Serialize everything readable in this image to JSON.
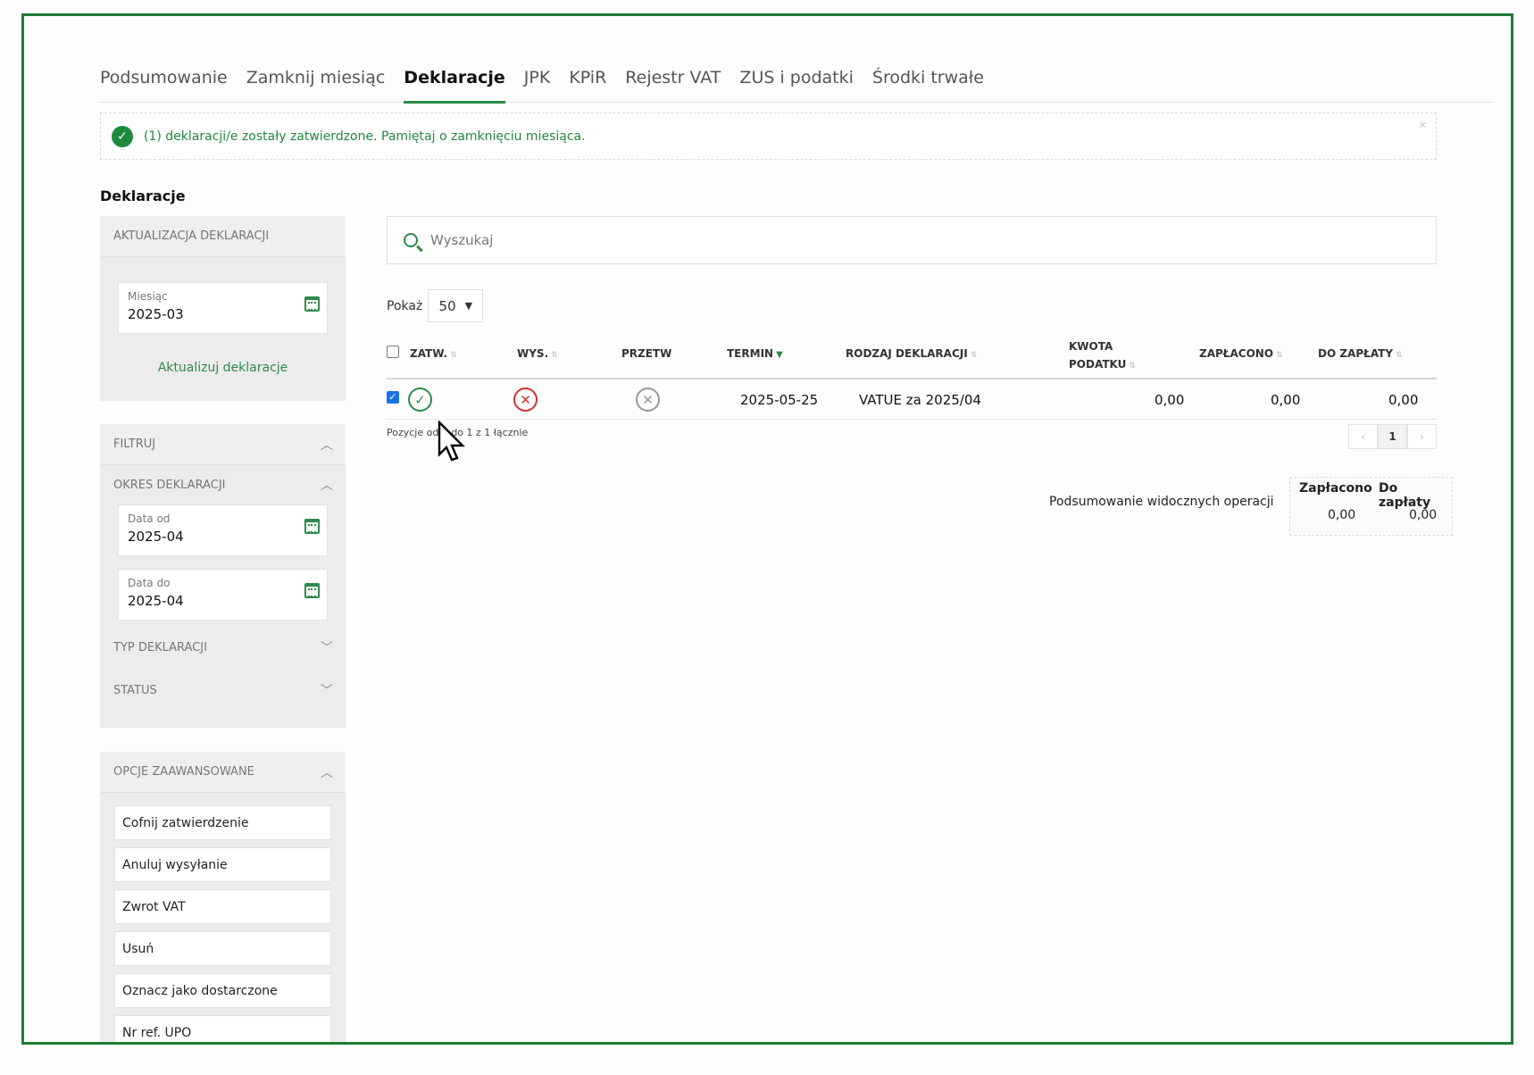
{
  "tabs": [
    {
      "label": "Podsumowanie",
      "active": false
    },
    {
      "label": "Zamknij miesiąc",
      "active": false
    },
    {
      "label": "Deklaracje",
      "active": true
    },
    {
      "label": "JPK",
      "active": false
    },
    {
      "label": "KPiR",
      "active": false
    },
    {
      "label": "Rejestr VAT",
      "active": false
    },
    {
      "label": "ZUS i podatki",
      "active": false
    },
    {
      "label": "Środki trwałe",
      "active": false
    }
  ],
  "alert": {
    "message": "(1) deklaracji/e zostały zatwierdzone. Pamiętaj o zamknięciu miesiąca.",
    "close": "×"
  },
  "page_title": "Deklaracje",
  "update_panel": {
    "title": "AKTUALIZACJA DEKLARACJI",
    "month_label": "Miesiąc",
    "month_value": "2025-03",
    "update_link": "Aktualizuj deklaracje"
  },
  "filter_panel": {
    "title": "FILTRUJ",
    "period_title": "OKRES DEKLARACJI",
    "date_from_label": "Data od",
    "date_from_value": "2025-04",
    "date_to_label": "Data do",
    "date_to_value": "2025-04",
    "type_title": "TYP DEKLARACJI",
    "status_title": "STATUS"
  },
  "advanced_panel": {
    "title": "OPCJE ZAAWANSOWANE",
    "buttons": [
      "Cofnij zatwierdzenie",
      "Anuluj wysyłanie",
      "Zwrot VAT",
      "Usuń",
      "Oznacz jako dostarczone",
      "Nr ref. UPO"
    ]
  },
  "search": {
    "placeholder": "Wyszukaj"
  },
  "page_size": {
    "label": "Pokaż",
    "value": "50"
  },
  "table": {
    "headers": {
      "zatw": "ZATW.",
      "wys": "WYS.",
      "przetw": "PRZETW",
      "termin": "TERMIN",
      "rodzaj": "RODZAJ DEKLARACJI",
      "kwota_line1": "KWOTA",
      "kwota_line2": "PODATKU",
      "zaplacono": "ZAPŁACONO",
      "do_zaplaty": "DO ZAPŁATY"
    },
    "rows": [
      {
        "selected": true,
        "zatw": "approved",
        "wys": "error",
        "przetw": "not-processed",
        "termin": "2025-05-25",
        "rodzaj": "VATUE za 2025/04",
        "kwota": "0,00",
        "zaplacono": "0,00",
        "do_zaplaty": "0,00"
      }
    ],
    "footer_info": "Pozycje od 1 do 1 z 1 łącznie",
    "pager": {
      "prev": "‹",
      "current": "1",
      "next": "›"
    }
  },
  "summary": {
    "label": "Podsumowanie widocznych operacji",
    "paid_header": "Zapłacono",
    "due_header": "Do zapłaty",
    "paid_value": "0,00",
    "due_value": "0,00"
  },
  "colors": {
    "accent": "#2e8a4a",
    "error": "#d32f2f",
    "frame": "#1f7a3a",
    "checkbox": "#1a73e8"
  }
}
